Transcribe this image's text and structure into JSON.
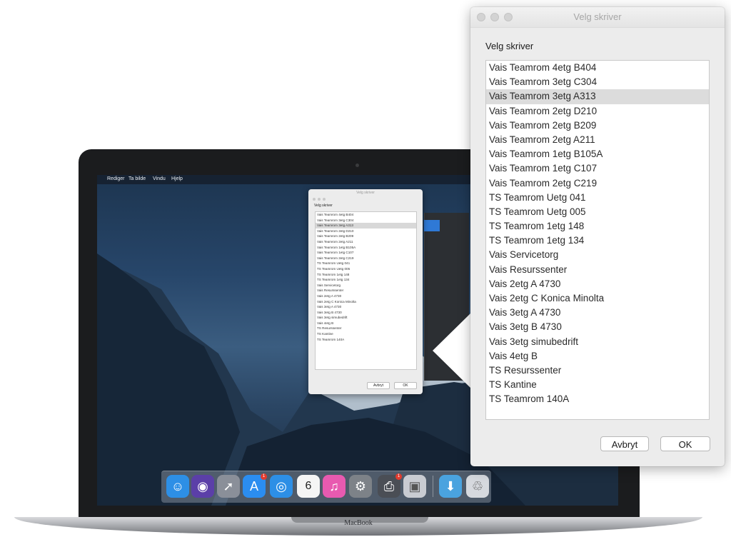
{
  "laptop": {
    "brand_label": "MacBook",
    "menubar": [
      "Rediger",
      "Ta bilde",
      "Vindu",
      "Hjelp"
    ]
  },
  "mini_dialog": {
    "title": "Velg skriver",
    "heading": "Velg skriver",
    "cancel_label": "Avbryt",
    "ok_label": "OK"
  },
  "dock": {
    "items": [
      {
        "icon": "finder-icon",
        "color": "#2d8fe6"
      },
      {
        "icon": "siri-icon",
        "color": "#5b3fa8"
      },
      {
        "icon": "launchpad-icon",
        "color": "#8a8f99"
      },
      {
        "icon": "app-store-icon",
        "color": "#2b8df0",
        "badge": "1"
      },
      {
        "icon": "safari-icon",
        "color": "#2d8fe6"
      },
      {
        "icon": "calendar-icon",
        "color": "#f5f5f5",
        "text": "6"
      },
      {
        "icon": "itunes-icon",
        "color": "#e85ab0"
      },
      {
        "icon": "system-preferences-icon",
        "color": "#7d8288"
      },
      {
        "icon": "printer-icon",
        "color": "#4a4e55",
        "badge": "1"
      },
      {
        "icon": "preview-icon",
        "color": "#c9ccd2"
      },
      {
        "icon": "downloads-folder-icon",
        "color": "#4aa3df"
      },
      {
        "icon": "trash-icon",
        "color": "#d6d9de"
      }
    ]
  },
  "dialog": {
    "window_title": "Velg skriver",
    "heading": "Velg skriver",
    "printers": [
      "Vais Teamrom 4etg B404",
      "Vais Teamrom 3etg C304",
      "Vais Teamrom 3etg A313",
      "Vais Teamrom 2etg D210",
      "Vais Teamrom 2etg B209",
      "Vais Teamrom 2etg A211",
      "Vais Teamrom 1etg B105A",
      "Vais Teamrom 1etg C107",
      "Vais Teamrom 2etg C219",
      "TS Teamrom Uetg 041",
      "TS Teamrom Uetg 005",
      "TS Teamrom 1etg 148",
      "TS Teamrom 1etg 134",
      "Vais Servicetorg",
      "Vais Resurssenter",
      "Vais 2etg A 4730",
      "Vais 2etg C Konica Minolta",
      "Vais 3etg A 4730",
      "Vais 3etg B 4730",
      "Vais 3etg simubedrift",
      "Vais 4etg B",
      "TS Resurssenter",
      "TS Kantine",
      "TS Teamrom 140A"
    ],
    "selected_index": 2,
    "cancel_label": "Avbryt",
    "ok_label": "OK"
  }
}
